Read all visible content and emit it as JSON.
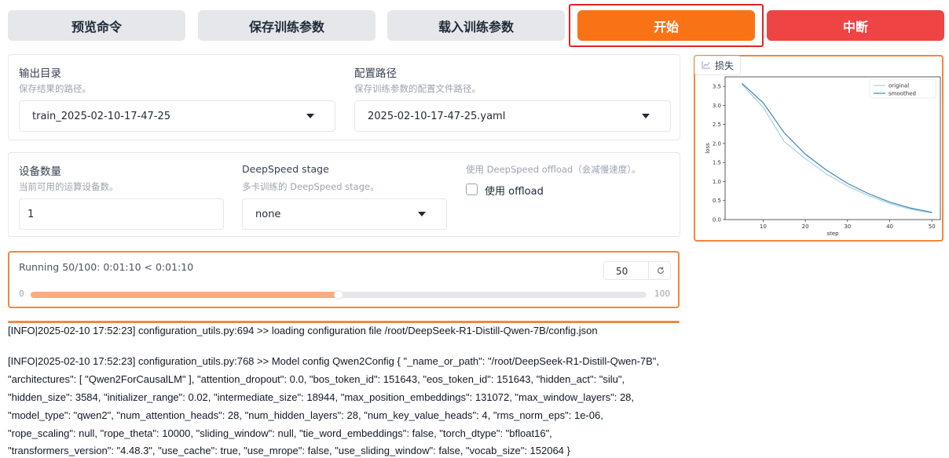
{
  "toolbar": {
    "preview_label": "预览命令",
    "save_label": "保存训练参数",
    "load_label": "载入训练参数",
    "start_label": "开始",
    "stop_label": "中断"
  },
  "output": {
    "dir_label": "输出目录",
    "dir_info": "保存结果的路径。",
    "dir_value": "train_2025-02-10-17-47-25",
    "config_label": "配置路径",
    "config_info": "保存训练参数的配置文件路径。",
    "config_value": "2025-02-10-17-47-25.yaml"
  },
  "devices": {
    "count_label": "设备数量",
    "count_info": "当前可用的运算设备数。",
    "count_value": "1",
    "ds_label": "DeepSpeed stage",
    "ds_info": "多卡训练的 DeepSpeed stage。",
    "ds_value": "none",
    "offload_info": "使用 DeepSpeed offload（会减慢速度）。",
    "offload_label": "使用 offload",
    "offload_checked": false
  },
  "progress": {
    "text": "Running 50/100: 0:01:10 < 0:01:10",
    "value": 50,
    "value_text": "50",
    "min": "0",
    "max": "100",
    "fill_color": "#f8ad7c"
  },
  "chart_tab": {
    "label": "损失",
    "icon": "chart-icon"
  },
  "chart_data": {
    "type": "line",
    "xlabel": "step",
    "ylabel": "loss",
    "xlim": [
      1,
      52
    ],
    "ylim": [
      0,
      3.75
    ],
    "xticks": [
      "10",
      "20",
      "30",
      "40",
      "50"
    ],
    "yticks": [
      "0.0",
      "0.5",
      "1.0",
      "1.5",
      "2.0",
      "2.5",
      "3.0",
      "3.5"
    ],
    "legend_position": "top-right",
    "grid": false,
    "series": [
      {
        "name": "original",
        "color": "#a9cfe6",
        "x": [
          5,
          10,
          15,
          20,
          25,
          30,
          35,
          40,
          45,
          50
        ],
        "y": [
          3.55,
          2.95,
          2.05,
          1.6,
          1.2,
          0.88,
          0.63,
          0.42,
          0.27,
          0.17
        ]
      },
      {
        "name": "smoothed",
        "color": "#3d84b8",
        "x": [
          5,
          10,
          15,
          20,
          25,
          30,
          35,
          40,
          45,
          50
        ],
        "y": [
          3.58,
          3.07,
          2.28,
          1.72,
          1.3,
          0.95,
          0.68,
          0.46,
          0.3,
          0.19
        ]
      }
    ]
  },
  "log": {
    "lines": [
      "[INFO|2025-02-10 17:52:23] configuration_utils.py:694 >> loading configuration file /root/DeepSeek-R1-Distill-Qwen-7B/config.json",
      "[INFO|2025-02-10 17:52:23] configuration_utils.py:768 >> Model config Qwen2Config { \"_name_or_path\": \"/root/DeepSeek-R1-Distill-Qwen-7B\",",
      "\"architectures\": [ \"Qwen2ForCausalLM\" ], \"attention_dropout\": 0.0, \"bos_token_id\": 151643, \"eos_token_id\": 151643, \"hidden_act\": \"silu\",",
      "\"hidden_size\": 3584, \"initializer_range\": 0.02, \"intermediate_size\": 18944, \"max_position_embeddings\": 131072, \"max_window_layers\": 28,",
      "\"model_type\": \"qwen2\", \"num_attention_heads\": 28, \"num_hidden_layers\": 28, \"num_key_value_heads\": 4, \"rms_norm_eps\": 1e-06,",
      "\"rope_scaling\": null, \"rope_theta\": 10000, \"sliding_window\": null, \"tie_word_embeddings\": false, \"torch_dtype\": \"bfloat16\",",
      "\"transformers_version\": \"4.48.3\", \"use_cache\": true, \"use_mrope\": false, \"use_sliding_window\": false, \"vocab_size\": 152064 }"
    ]
  }
}
